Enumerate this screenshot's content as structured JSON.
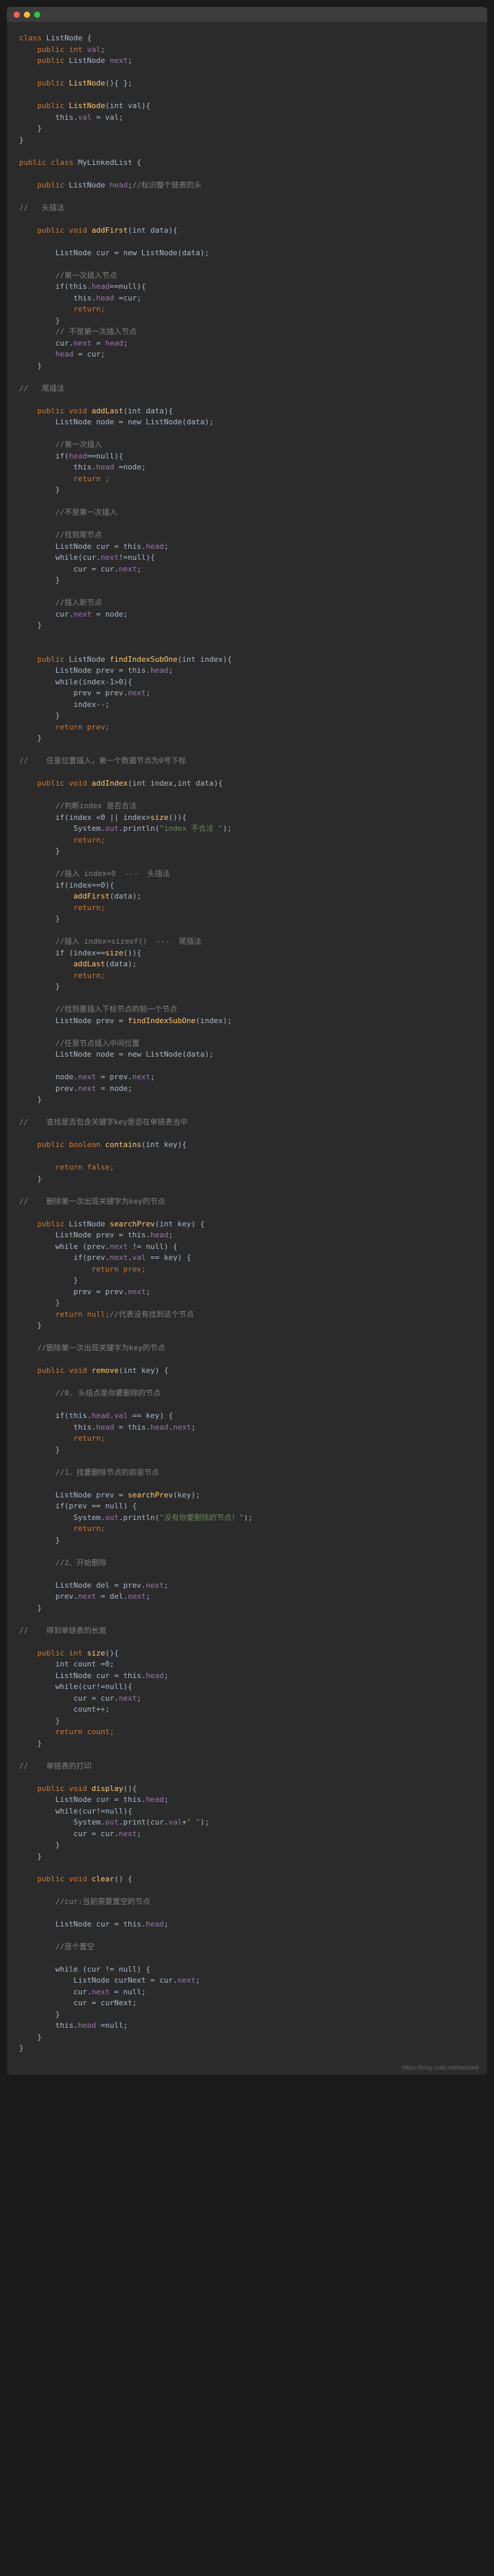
{
  "watermark": "https://blog.csdn.net/weixin6",
  "c": {
    "l1": "class",
    "l1b": " ListNode {",
    "l2a": "    public int ",
    "l2b": "val",
    "l2c": ";",
    "l3a": "    public ",
    "l3b": "ListNode ",
    "l3c": "next",
    "l3d": ";",
    "l4a": "    public ",
    "l4b": "ListNode",
    "l4c": "(){ };",
    "l5a": "    public ",
    "l5b": "ListNode",
    "l5c": "(int ",
    "l5d": "val",
    "l5e": "){",
    "l6a": "        this.",
    "l6b": "val",
    "l6c": " = val;",
    "l7": "    }",
    "l8": "}",
    "l10a": "public class ",
    "l10b": "MyLinkedList {",
    "l11a": "    public ",
    "l11b": "ListNode ",
    "l11c": "head",
    "l11d": ";",
    "l11e": "//标识整个链表的头",
    "l13": "//   头插法",
    "l14a": "    public void ",
    "l14b": "addFirst",
    "l14c": "(int data){",
    "l15a": "        ListNode cur = new ListNode(data);",
    "l17": "        //第一次插入节点",
    "l18a": "        if(this.",
    "l18b": "head",
    "l18c": "==null){",
    "l19a": "            this.",
    "l19b": "head",
    "l19c": " =cur;",
    "l20": "            return;",
    "l21": "        }",
    "l22": "        // 不是第一次插入节点",
    "l23a": "        cur.",
    "l23b": "next",
    "l23c": " = ",
    "l23d": "head",
    "l23e": ";",
    "l24a": "        ",
    "l24b": "head",
    "l24c": " = cur;",
    "l25": "    }",
    "l27": "//   尾插法",
    "l28a": "    public void ",
    "l28b": "addLast",
    "l28c": "(int data){",
    "l29": "        ListNode node = new ListNode(data);",
    "l31": "        //第一次插入",
    "l32a": "        if(",
    "l32b": "head",
    "l32c": "==null){",
    "l33a": "            this.",
    "l33b": "head",
    "l33c": " =node;",
    "l34": "            return ;",
    "l35": "        }",
    "l37": "        //不是第一次插入",
    "l39": "        //找到尾节点",
    "l40a": "        ListNode cur = this.",
    "l40b": "head",
    "l40c": ";",
    "l41a": "        while(cur.",
    "l41b": "next",
    "l41c": "!=null){",
    "l42a": "            cur = cur.",
    "l42b": "next",
    "l42c": ";",
    "l43": "        }",
    "l45": "        //插入新节点",
    "l46a": "        cur.",
    "l46b": "next",
    "l46c": " = node;",
    "l47": "    }",
    "l50a": "    public ",
    "l50b": "ListNode ",
    "l50c": "findIndexSubOne",
    "l50d": "(int index){",
    "l51a": "        ListNode prev = this.",
    "l51b": "head",
    "l51c": ";",
    "l52": "        while(index-1>0){",
    "l53a": "            prev = prev.",
    "l53b": "next",
    "l53c": ";",
    "l54": "            index--;",
    "l55": "        }",
    "l56": "        return prev;",
    "l57": "    }",
    "l59": "//    任意位置插入，第一个数据节点为0号下标",
    "l60a": "    public void ",
    "l60b": "addIndex",
    "l60c": "(int index,int data){",
    "l62": "        //判断index 是否合法",
    "l63a": "        if(index <0 || index>",
    "l63b": "size",
    "l63c": "()){",
    "l64a": "            System.",
    "l64b": "out",
    "l64c": ".println(",
    "l64d": "\"index 不合法 \"",
    "l64e": ");",
    "l65": "            return;",
    "l66": "        }",
    "l68": "        //插入 index=0  ---  头插法",
    "l69": "        if(index==0){",
    "l70a": "            ",
    "l70b": "addFirst",
    "l70c": "(data);",
    "l71": "            return;",
    "l72": "        }",
    "l74": "        //插入 index=sizeof()  ---  尾插法",
    "l75a": "        if (index==",
    "l75b": "size",
    "l75c": "()){",
    "l76a": "            ",
    "l76b": "addLast",
    "l76c": "(data);",
    "l77": "            return;",
    "l78": "        }",
    "l80": "        //找到要插入下标节点的前一个节点",
    "l81a": "        ListNode prev = ",
    "l81b": "findIndexSubOne",
    "l81c": "(index);",
    "l83": "        //任意节点插入中间位置",
    "l84": "        ListNode node = new ListNode(data);",
    "l86a": "        node.",
    "l86b": "next",
    "l86c": " = prev.",
    "l86d": "next",
    "l86e": ";",
    "l87a": "        prev.",
    "l87b": "next",
    "l87c": " = node;",
    "l88": "    }",
    "l90": "//    查找是否包含关键字key是否在单链表当中",
    "l91a": "    public boolean ",
    "l91b": "contains",
    "l91c": "(int key){",
    "l93": "        return false;",
    "l94": "    }",
    "l96": "//    删除第一次出现关键字为key的节点",
    "l97a": "    public ",
    "l97b": "ListNode ",
    "l97c": "searchPrev",
    "l97d": "(int key) {",
    "l98a": "        ListNode prev = this.",
    "l98b": "head",
    "l98c": ";",
    "l99a": "        while (prev.",
    "l99b": "next",
    "l99c": " != null) {",
    "l100a": "            if(prev.",
    "l100b": "next",
    "l100c": ".",
    "l100d": "val",
    "l100e": " == key) {",
    "l101": "                return prev;",
    "l102": "            }",
    "l103a": "            prev = prev.",
    "l103b": "next",
    "l103c": ";",
    "l104": "        }",
    "l105a": "        return null;",
    "l105b": "//代表没有找到这个节点",
    "l106": "    }",
    "l108": "    //删除第一次出现关键字为key的节点",
    "l109a": "    public void ",
    "l109b": "remove",
    "l109c": "(int key) {",
    "l111": "        //0. 头结点是你要删除的节点",
    "l112a": "        if(this.",
    "l112b": "head",
    "l112c": ".",
    "l112d": "val",
    "l112e": " == key) {",
    "l113a": "            this.",
    "l113b": "head",
    "l113c": " = this.",
    "l113d": "head",
    "l113e": ".",
    "l113f": "next",
    "l113g": ";",
    "l114": "            return;",
    "l115": "        }",
    "l117": "        //1、找要删除节点的前驱节点",
    "l118a": "        ListNode prev = ",
    "l118b": "searchPrev",
    "l118c": "(key);",
    "l119": "        if(prev == null) {",
    "l120a": "            System.",
    "l120b": "out",
    "l120c": ".println(",
    "l120d": "\"没有你要删除的节点！\"",
    "l120e": ");",
    "l121": "            return;",
    "l122": "        }",
    "l124": "        //2、开始删除",
    "l125a": "        ListNode del = prev.",
    "l125b": "next",
    "l125c": ";",
    "l126a": "        prev.",
    "l126b": "next",
    "l126c": " = del.",
    "l126d": "next",
    "l126e": ";",
    "l127": "    }",
    "l129": "//    得到单链表的长度",
    "l130a": "    public int ",
    "l130b": "size",
    "l130c": "(){",
    "l131": "        int count =0;",
    "l132a": "        ListNode cur = this.",
    "l132b": "head",
    "l132c": ";",
    "l133": "        while(cur!=null){",
    "l134a": "            cur = cur.",
    "l134b": "next",
    "l134c": ";",
    "l135": "            count++;",
    "l136": "        }",
    "l137": "        return count;",
    "l138": "    }",
    "l140": "//    单链表的打印",
    "l141a": "    public void ",
    "l141b": "display",
    "l141c": "(){",
    "l142a": "        ListNode cur = this.",
    "l142b": "head",
    "l142c": ";",
    "l143": "        while(cur!=null){",
    "l144a": "            System.",
    "l144b": "out",
    "l144c": ".print(cur.",
    "l144d": "val",
    "l144e": "+",
    "l144f": "\" \"",
    "l144g": ");",
    "l145a": "            cur = cur.",
    "l145b": "next",
    "l145c": ";",
    "l146": "        }",
    "l147": "    }",
    "l149a": "    public void ",
    "l149b": "clear",
    "l149c": "() {",
    "l151": "        //cur:当前需要置空的节点",
    "l152a": "        ListNode cur = this.",
    "l152b": "head",
    "l152c": ";",
    "l154": "        //逐个置空",
    "l155": "        while (cur != null) {",
    "l156a": "            ListNode curNext = cur.",
    "l156b": "next",
    "l156c": ";",
    "l157a": "            cur.",
    "l157b": "next",
    "l157c": " = null;",
    "l158": "            cur = curNext;",
    "l159": "        }",
    "l160a": "        this.",
    "l160b": "head",
    "l160c": " =null;",
    "l161": "    }",
    "l162": "}"
  }
}
